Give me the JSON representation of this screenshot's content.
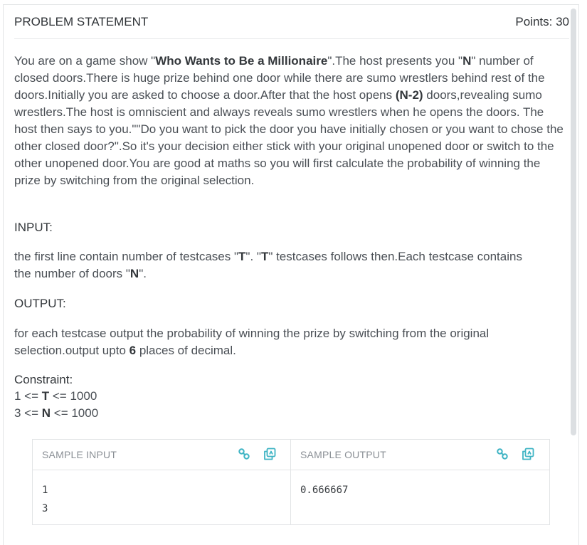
{
  "header": {
    "title": "PROBLEM STATEMENT",
    "points": "Points: 30"
  },
  "statement": {
    "p1_a": "You are on a game show \"",
    "p1_show": "Who Wants to Be a Millionaire",
    "p1_b": "\".The host presents you \"",
    "p1_n": "N",
    "p1_c": "\" number of closed doors.There is huge prize behind one door while there are sumo wrestlers behind rest of the doors.Initially you are asked to choose a door.After that the host opens ",
    "p1_n2": "(N-2)",
    "p1_d": " doors,revealing sumo wrestlers.The host is omniscient and always reveals sumo wrestlers when he opens the doors. The host then says to you.\"\"Do you want to pick the door you have initially chosen or you want to chose the other closed door?\".So it's your decision either stick with your original unopened door or switch to the other unopened door.You are good at maths so you will first calculate the probability of winning the prize by switching from the original selection."
  },
  "input_section": {
    "heading": "INPUT:",
    "t1": "the first line contain number of testcases \"",
    "T1": "T",
    "t2": "\". \"",
    "T2": "T",
    "t3": "\" testcases follows then.Each testcase contains the number of doors \"",
    "N": "N",
    "t4": "\"."
  },
  "output_section": {
    "heading": "OUTPUT:",
    "t1": "for each testcase output the probability of winning the prize by switching from the original selection.output upto ",
    "six": "6",
    "t2": " places of decimal."
  },
  "constraint": {
    "heading": "Constraint:",
    "line1_a": "1 <= ",
    "line1_var": "T",
    "line1_b": " <= 1000",
    "line2_a": "3 <= ",
    "line2_var": "N",
    "line2_b": " <= 1000"
  },
  "samples": {
    "input_title": "SAMPLE INPUT",
    "output_title": "SAMPLE OUTPUT",
    "input_text": "1\n3",
    "output_text": "0.666667"
  },
  "icons": [
    "link-icon",
    "copy-icon"
  ],
  "colors": {
    "accent": "#3fb4c4",
    "heading": "#2f3337",
    "text": "#4a4f55",
    "border": "#e2e4e6"
  }
}
